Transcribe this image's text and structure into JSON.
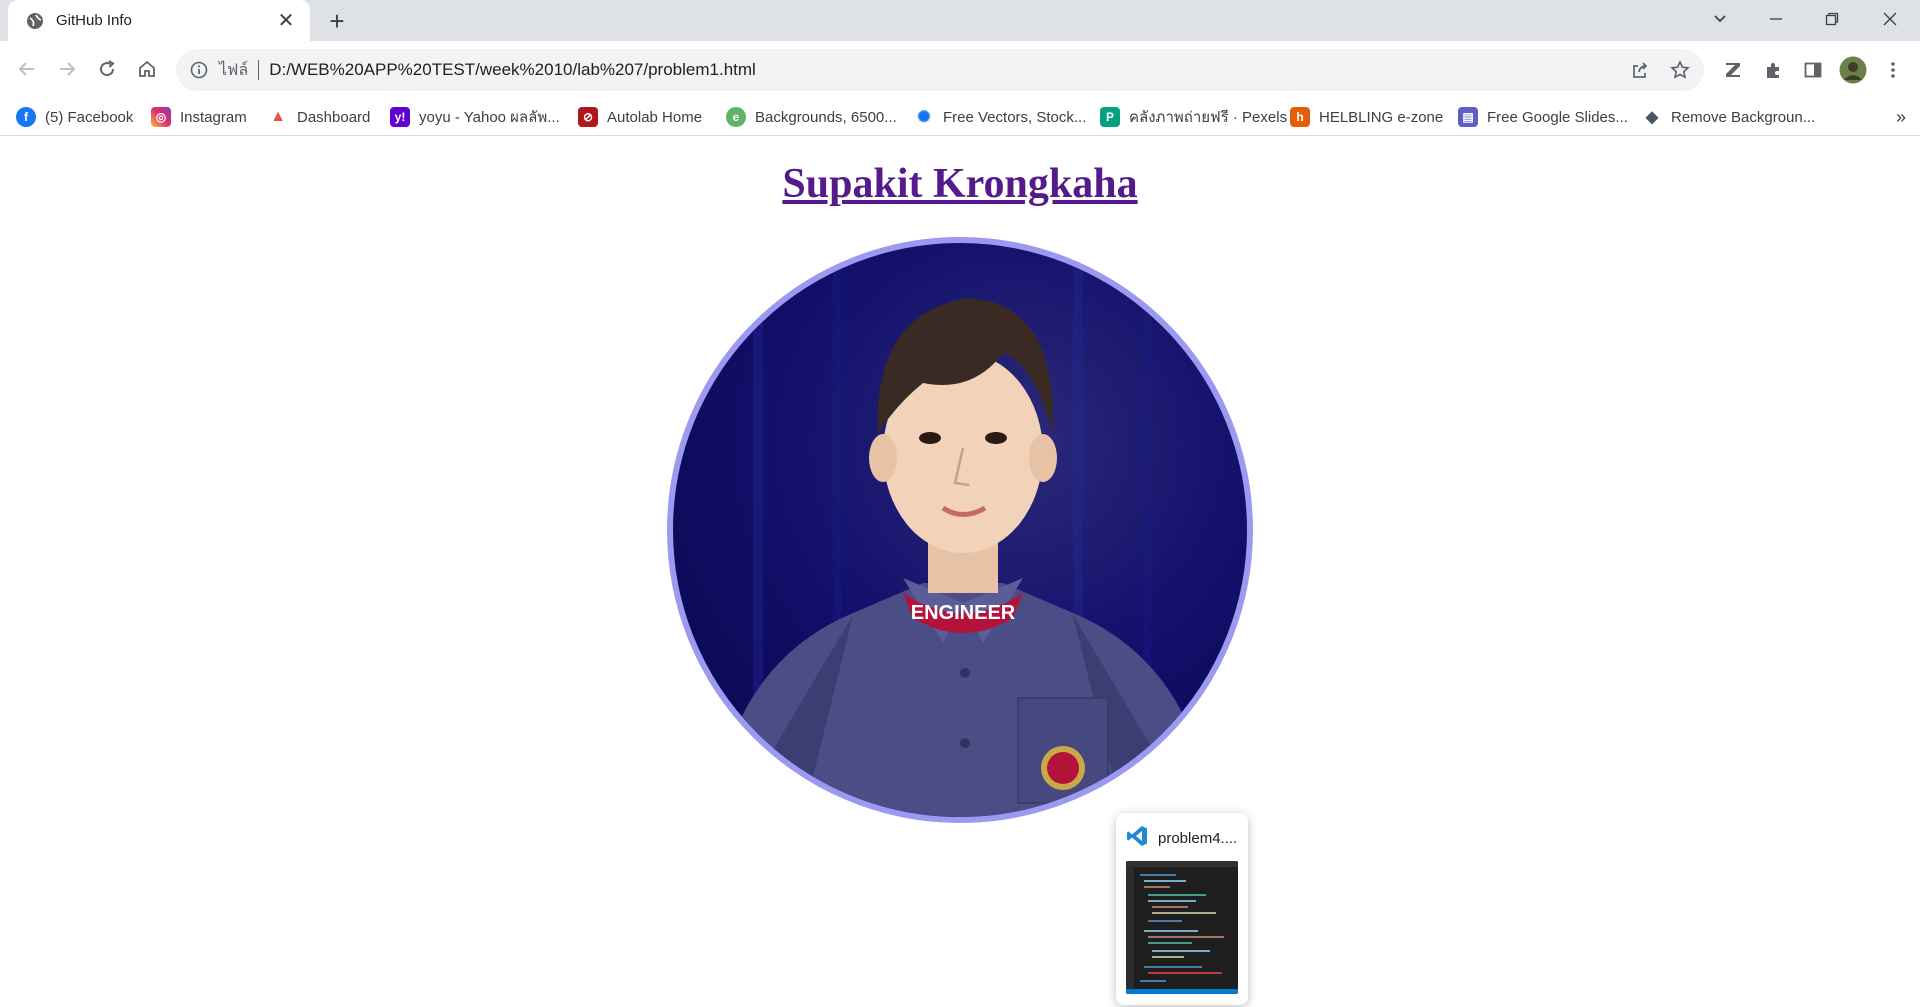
{
  "browser": {
    "tab": {
      "title": "GitHub Info"
    },
    "window_controls": [
      "tab-search",
      "minimize",
      "restore",
      "close"
    ]
  },
  "omnibox": {
    "scheme_label": "ไฟล์",
    "url": "D:/WEB%20APP%20TEST/week%2010/lab%207/problem1.html"
  },
  "bookmarks": [
    {
      "label": "(5) Facebook",
      "icon": "facebook-icon",
      "color": "#1877f2"
    },
    {
      "label": "Instagram",
      "icon": "instagram-icon",
      "color": "#d6249f"
    },
    {
      "label": "Dashboard",
      "icon": "rocket-icon",
      "color": "#e8543d"
    },
    {
      "label": "yoyu - Yahoo ผลลัพ...",
      "icon": "yahoo-icon",
      "color": "#6001d2"
    },
    {
      "label": "Autolab Home",
      "icon": "autolab-icon",
      "color": "#b0161b"
    },
    {
      "label": "Backgrounds, 6500...",
      "icon": "backgrounds-icon",
      "color": "#5fb36b"
    },
    {
      "label": "Free Vectors, Stock...",
      "icon": "freepik-icon",
      "color": "#1273eb"
    },
    {
      "label": "คลังภาพถ่ายฟรี · Pexels",
      "icon": "pexels-icon",
      "color": "#05a081"
    },
    {
      "label": "HELBLING e-zone",
      "icon": "helbling-icon",
      "color": "#e35d0b"
    },
    {
      "label": "Free Google Slides...",
      "icon": "slides-icon",
      "color": "#5b5fc7"
    },
    {
      "label": "Remove Backgroun...",
      "icon": "removebg-icon",
      "color": "#4a5568"
    }
  ],
  "page": {
    "heading": "Supakit Krongkaha",
    "avatar_border_color": "#9b9af0"
  },
  "taskbar_preview": {
    "title": "problem4....",
    "app_icon": "vscode-icon"
  }
}
